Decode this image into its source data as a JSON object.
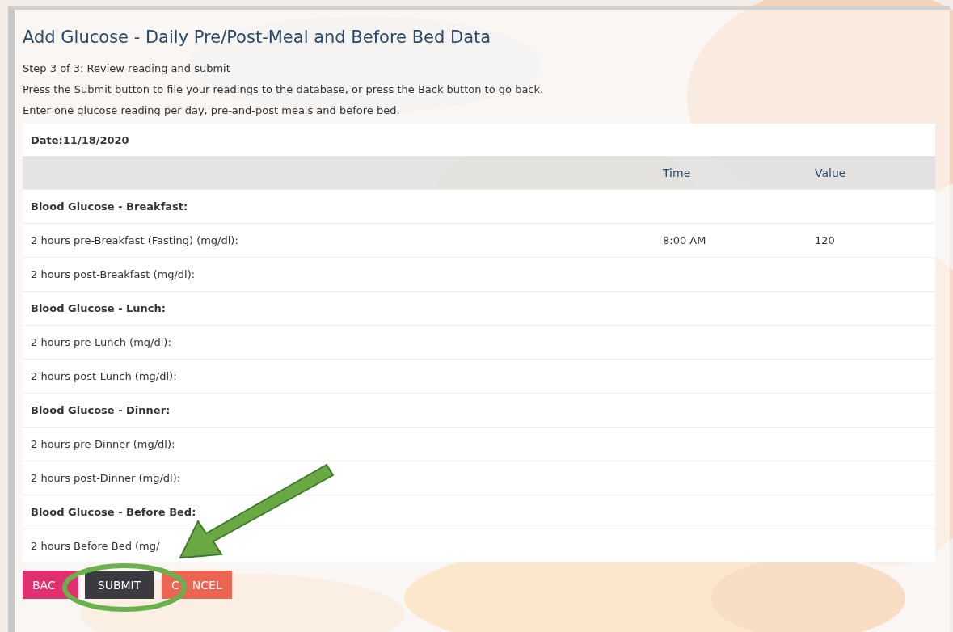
{
  "title": "Add Glucose - Daily Pre/Post-Meal and Before Bed Data",
  "step": "Step 3 of 3: Review reading and submit",
  "instructions": [
    "Press the Submit button to file your readings to the database, or press the Back button to go back.",
    "Enter one glucose reading per day, pre-and-post meals and before bed."
  ],
  "date": "Date:11/18/2020",
  "columns": [
    "Time",
    "Value"
  ],
  "rows": [
    {
      "kind": "group",
      "label": "Blood Glucose - Breakfast:"
    },
    {
      "kind": "reading",
      "label": "2 hours pre-Breakfast (Fasting) (mg/dl):",
      "time": "8:00 AM",
      "value": "120"
    },
    {
      "kind": "reading",
      "label": "2 hours post-Breakfast (mg/dl):"
    },
    {
      "kind": "group",
      "label": "Blood Glucose - Lunch:"
    },
    {
      "kind": "reading",
      "label": "2 hours pre-Lunch (mg/dl):"
    },
    {
      "kind": "reading",
      "label": "2 hours post-Lunch (mg/dl):"
    },
    {
      "kind": "group",
      "label": "Blood Glucose - Dinner:"
    },
    {
      "kind": "reading",
      "label": "2 hours pre-Dinner (mg/dl):"
    },
    {
      "kind": "reading",
      "label": "2 hours post-Dinner (mg/dl):"
    },
    {
      "kind": "group",
      "label": "Blood Glucose - Before Bed:"
    },
    {
      "kind": "reading",
      "label": "2 hours Before Bed (mg/"
    }
  ],
  "buttons": [
    {
      "kind": "back",
      "parts": [
        "BAC"
      ]
    },
    {
      "kind": "submit",
      "parts": [
        "SUBMIT"
      ]
    },
    {
      "kind": "cancel",
      "parts": [
        "C",
        "NCEL"
      ]
    }
  ]
}
